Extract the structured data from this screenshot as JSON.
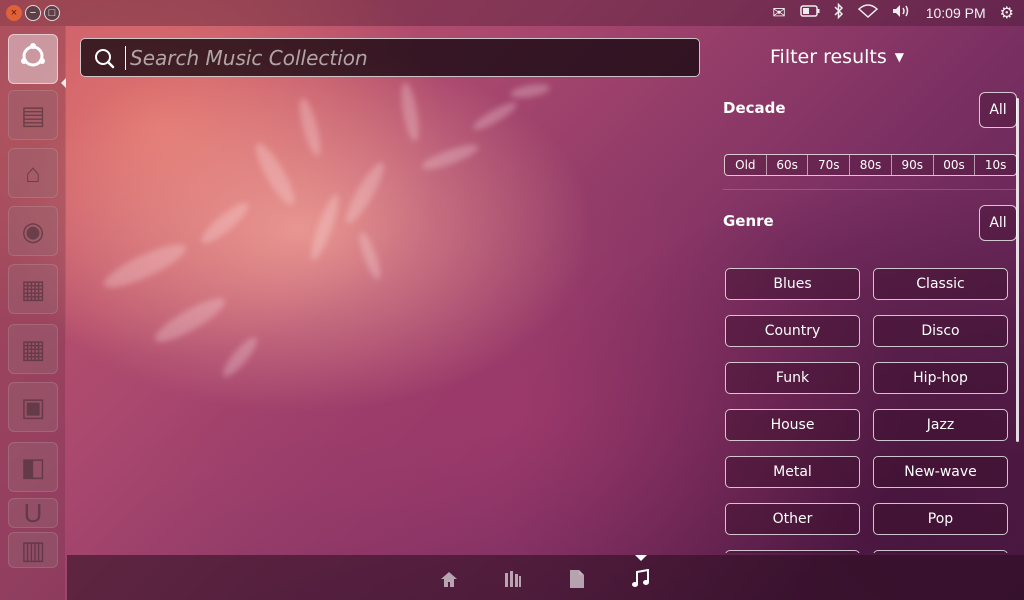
{
  "top_panel": {
    "clock": "10:09 PM",
    "indicators": [
      "mail-icon",
      "battery-icon",
      "bluetooth-icon",
      "wifi-icon",
      "volume-icon",
      "session-gear-icon"
    ]
  },
  "launcher": {
    "items": [
      {
        "name": "dash-home",
        "icon": "ubuntu-logo-icon",
        "active": true
      },
      {
        "name": "disk-utility",
        "icon": "disk-icon",
        "active": false
      },
      {
        "name": "home-folder",
        "icon": "folder-home-icon",
        "active": false
      },
      {
        "name": "firefox",
        "icon": "firefox-icon",
        "active": false
      },
      {
        "name": "writer",
        "icon": "document-icon",
        "active": false
      },
      {
        "name": "calc",
        "icon": "spreadsheet-icon",
        "active": false
      },
      {
        "name": "impress",
        "icon": "presentation-icon",
        "active": false
      },
      {
        "name": "software-center",
        "icon": "shopping-bag-icon",
        "active": false
      },
      {
        "name": "ubuntu-one",
        "icon": "ubuntu-one-icon",
        "active": false
      },
      {
        "name": "workspaces",
        "icon": "workspace-icon",
        "active": false
      }
    ]
  },
  "search": {
    "placeholder": "Search Music Collection",
    "value": ""
  },
  "filters": {
    "header": "Filter results",
    "decade": {
      "title": "Decade",
      "all_label": "All",
      "options": [
        "Old",
        "60s",
        "70s",
        "80s",
        "90s",
        "00s",
        "10s"
      ]
    },
    "genre": {
      "title": "Genre",
      "all_label": "All",
      "options": [
        "Blues",
        "Classic",
        "Country",
        "Disco",
        "Funk",
        "Hip-hop",
        "House",
        "Jazz",
        "Metal",
        "New-wave",
        "Other",
        "Pop",
        "",
        ""
      ]
    }
  },
  "lenses": [
    {
      "name": "home-lens",
      "icon": "home-icon",
      "active": false
    },
    {
      "name": "applications-lens",
      "icon": "applications-icon",
      "active": false
    },
    {
      "name": "files-lens",
      "icon": "file-icon",
      "active": false
    },
    {
      "name": "music-lens",
      "icon": "music-note-icon",
      "active": true
    }
  ],
  "colors": {
    "accent": "#ffffff",
    "close_button": "#e0603a"
  }
}
